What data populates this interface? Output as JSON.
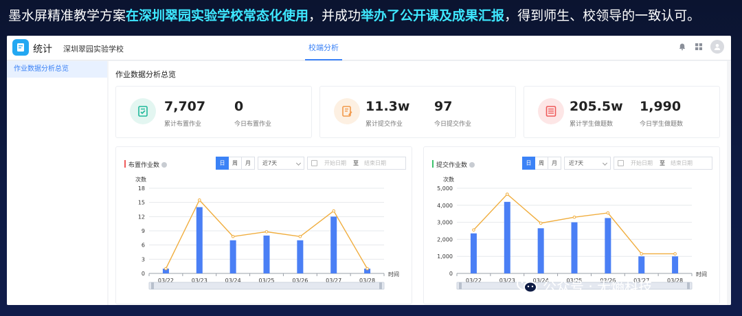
{
  "banner": {
    "part1": "墨水屏精准教学方案",
    "part2": "在深圳翠园实验学校常态化使用",
    "part3": "，并成功",
    "part4": "举办了公开课及成果汇报",
    "part5": "，得到师生、校领导的一致认可。"
  },
  "app": {
    "name": "统计",
    "school": "深圳翠园实验学校",
    "nav_tab": "校端分析",
    "accent": "#3b82f6"
  },
  "sidebar": {
    "items": [
      {
        "label": "作业数据分析总览"
      }
    ]
  },
  "main": {
    "section_title": "作业数据分析总览"
  },
  "stats": [
    {
      "icon": "assignment-icon",
      "color": "#1fb89a",
      "bg": "#e3f6f1",
      "a_value": "7,707",
      "a_label": "累计布置作业",
      "b_value": "0",
      "b_label": "今日布置作业"
    },
    {
      "icon": "submit-icon",
      "color": "#f2994a",
      "bg": "#fdf0e2",
      "a_value": "11.3w",
      "a_label": "累计提交作业",
      "b_value": "97",
      "b_label": "今日提交作业"
    },
    {
      "icon": "questions-icon",
      "color": "#ef5a5a",
      "bg": "#fde6e6",
      "a_value": "205.5w",
      "a_label": "累计学生做题数",
      "b_value": "1,990",
      "b_label": "今日学生做题数"
    }
  ],
  "controls": {
    "day": "日",
    "week": "周",
    "month": "月",
    "range": "近7天",
    "start_placeholder": "开始日期",
    "separator": "至",
    "end_placeholder": "结束日期"
  },
  "chart_data": [
    {
      "type": "bar",
      "title": "布置作业数",
      "title_color": "#ef5a5a",
      "ylabel": "次数",
      "xlabel": "时间",
      "categories": [
        "03/22",
        "03/23",
        "03/24",
        "03/25",
        "03/26",
        "03/27",
        "03/28"
      ],
      "values": [
        1,
        14,
        7,
        8,
        7,
        12,
        1
      ],
      "line_values": [
        1,
        15.5,
        7.8,
        8.8,
        7.8,
        13.2,
        1
      ],
      "ylim": [
        0,
        18
      ],
      "yticks": [
        0,
        3,
        6,
        9,
        12,
        15,
        18
      ],
      "ytick_labels": [
        "0",
        "3",
        "6",
        "9",
        "12",
        "15",
        "18"
      ],
      "bar_color": "#4a7ff5",
      "line_color": "#f0ad3d",
      "grid": true
    },
    {
      "type": "bar",
      "title": "提交作业数",
      "title_color": "#3cc26b",
      "ylabel": "次数",
      "xlabel": "时间",
      "categories": [
        "03/22",
        "03/23",
        "03/24",
        "03/25",
        "03/26",
        "03/27",
        "03/28"
      ],
      "values": [
        2350,
        4200,
        2650,
        3000,
        3250,
        1000,
        1000
      ],
      "line_values": [
        2550,
        4650,
        2950,
        3300,
        3550,
        1150,
        1150
      ],
      "ylim": [
        0,
        5000
      ],
      "yticks": [
        0,
        1000,
        2000,
        3000,
        4000,
        5000
      ],
      "ytick_labels": [
        "0",
        "1,000",
        "2,000",
        "3,000",
        "4,000",
        "5,000"
      ],
      "bar_color": "#4a7ff5",
      "line_color": "#f0ad3d",
      "grid": true
    }
  ],
  "watermark": {
    "text": "公众号 · 无熵科技",
    "icon": "wechat-icon"
  }
}
